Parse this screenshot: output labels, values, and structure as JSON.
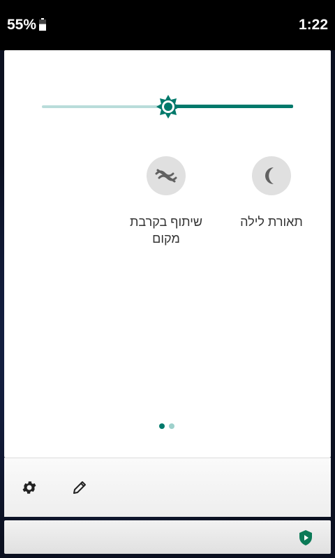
{
  "status_bar": {
    "battery_percent": "55%",
    "battery_icon": "battery-icon",
    "time": "1:22"
  },
  "brightness": {
    "level": 0.5,
    "icon": "brightness-icon"
  },
  "tiles": [
    {
      "id": "night-light",
      "label": "תאורת לילה",
      "icon": "moon-icon"
    },
    {
      "id": "nearby-share",
      "label": "שיתוף בקרבת מקום",
      "icon": "nearby-share-icon"
    }
  ],
  "pager": {
    "pages": 2,
    "current": 1
  },
  "footer": {
    "settings_icon": "gear-icon",
    "edit_icon": "pencil-icon"
  },
  "notification_bar": {
    "icon": "play-protect-icon"
  },
  "colors": {
    "accent": "#00796b",
    "accent_light": "#b9dcda",
    "tile_bg": "#e0e0e0",
    "tile_icon": "#616161"
  }
}
